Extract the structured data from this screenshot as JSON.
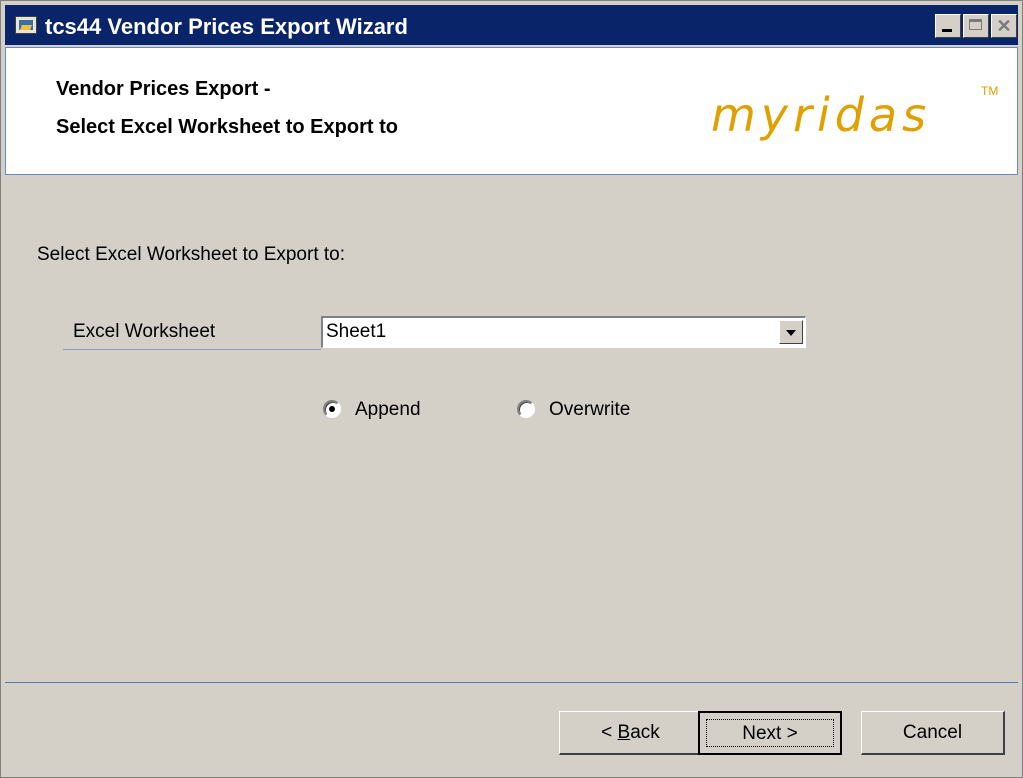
{
  "window": {
    "title": "tcs44 Vendor Prices Export Wizard"
  },
  "header": {
    "line1": "Vendor Prices Export -",
    "line2": "Select Excel Worksheet to Export to",
    "logo_text": "myridas",
    "logo_tm": "TM",
    "logo_color": "#e0a000"
  },
  "content": {
    "prompt": "Select Excel Worksheet to Export to:",
    "worksheet_label": "Excel Worksheet",
    "worksheet_value": "Sheet1",
    "radio_append": "Append",
    "radio_overwrite": "Overwrite",
    "selected_mode": "Append"
  },
  "buttons": {
    "back_prefix": "< ",
    "back_mnemonic": "B",
    "back_rest": "ack",
    "next": "Next >",
    "cancel": "Cancel"
  },
  "icons": {
    "app": "app-icon",
    "minimize": "minimize-icon",
    "maximize": "maximize-icon",
    "close": "close-icon",
    "dropdown": "chevron-down-icon"
  }
}
